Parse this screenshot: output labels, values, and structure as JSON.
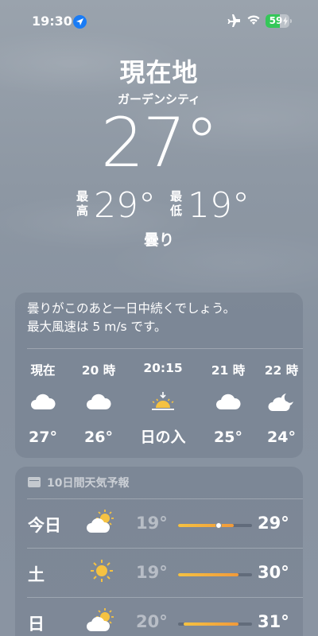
{
  "status_bar": {
    "time": "19:30",
    "battery_percent": "59",
    "battery_level": 0.59,
    "colors": {
      "location": "#1a7cf5",
      "battery": "#35c759"
    }
  },
  "location": {
    "city": "現在地",
    "sublocation": "ガーデンシティ",
    "temperature": "27°",
    "high_label": "最高",
    "high": "29°",
    "low_label": "最低",
    "low": "19°",
    "condition": "曇り"
  },
  "hourly": {
    "summary_line1": "曇りがこのあと一日中続くでしょう。",
    "summary_line2": "最大風速は 5 m/s です。",
    "items": [
      {
        "time": "現在",
        "icon": "cloud-icon",
        "temp": "27°"
      },
      {
        "time": "20 時",
        "icon": "cloud-icon",
        "temp": "26°"
      },
      {
        "time": "20:15",
        "icon": "sunset-icon",
        "temp": "日の入"
      },
      {
        "time": "21 時",
        "icon": "cloud-icon",
        "temp": "25°"
      },
      {
        "time": "22 時",
        "icon": "cloud-moon-icon",
        "temp": "24°"
      }
    ]
  },
  "daily": {
    "title": "10日間天気予報",
    "days": [
      {
        "day": "今日",
        "icon": "partly-sunny-icon",
        "low": "19°",
        "high": "29°",
        "range_start": 0.0,
        "range_end": 0.75,
        "current": 0.55
      },
      {
        "day": "土",
        "icon": "sun-icon",
        "low": "19°",
        "high": "30°",
        "range_start": 0.0,
        "range_end": 0.82
      },
      {
        "day": "日",
        "icon": "partly-sunny-icon",
        "low": "20°",
        "high": "31°",
        "range_start": 0.08,
        "range_end": 0.82
      }
    ]
  }
}
